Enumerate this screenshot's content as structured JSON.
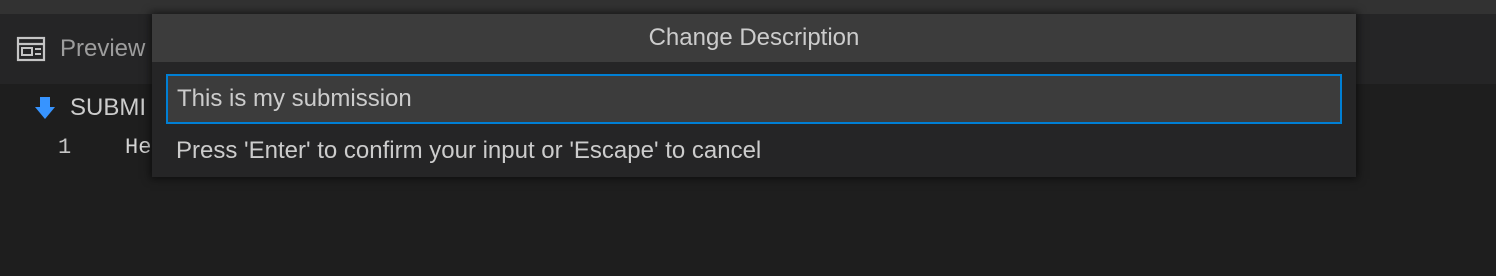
{
  "tab": {
    "label": "Preview",
    "icon": "preview-icon"
  },
  "editor": {
    "section_label": "SUBMI",
    "section_icon": "arrow-down-icon",
    "lines": [
      {
        "number": "1",
        "text": "He"
      }
    ]
  },
  "quick_input": {
    "title": "Change Description",
    "value": "This is my submission",
    "message": "Press 'Enter' to confirm your input or 'Escape' to cancel"
  },
  "colors": {
    "focus_border": "#007fd4",
    "arrow_icon": "#3794ff",
    "background": "#1e1e1e",
    "widget_background": "#252526"
  }
}
